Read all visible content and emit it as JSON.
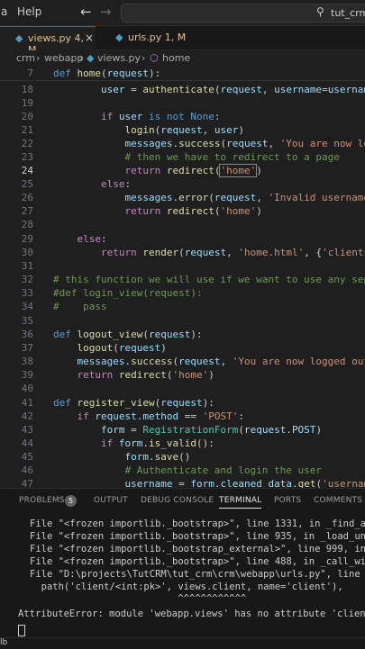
{
  "menu": {
    "item1": "a",
    "help": "Help"
  },
  "search": {
    "text": "tut_crm"
  },
  "tabs": [
    {
      "label": "views.py 4, M",
      "icon": "python-file-icon"
    },
    {
      "label": "urls.py 1, M",
      "icon": "python-file-icon"
    }
  ],
  "breadcrumb": {
    "part1": "crm",
    "part2": "webapp",
    "part3": "views.py",
    "part4": "home"
  },
  "editor": {
    "lines": [
      {
        "n": "7",
        "text": "def home(request):"
      },
      {
        "n": "18",
        "text": "        user = authenticate(request, username=username,"
      },
      {
        "n": "19",
        "text": ""
      },
      {
        "n": "20",
        "text": "        if user is not None:"
      },
      {
        "n": "21",
        "text": "            login(request, user)"
      },
      {
        "n": "22",
        "text": "            messages.success(request, 'You are now logge"
      },
      {
        "n": "23",
        "text": "            # then we have to redirect to a page"
      },
      {
        "n": "24",
        "text": "            return redirect('home')"
      },
      {
        "n": "25",
        "text": "        else:"
      },
      {
        "n": "26",
        "text": "            messages.error(request, 'Invalid username or"
      },
      {
        "n": "27",
        "text": "            return redirect('home')"
      },
      {
        "n": "28",
        "text": ""
      },
      {
        "n": "29",
        "text": "    else:"
      },
      {
        "n": "30",
        "text": "        return render(request, 'home.html', {'clients':"
      },
      {
        "n": "31",
        "text": ""
      },
      {
        "n": "32",
        "text": "# this function we will use if we want to use any sepera"
      },
      {
        "n": "33",
        "text": "#def login_view(request):"
      },
      {
        "n": "34",
        "text": "#    pass"
      },
      {
        "n": "35",
        "text": ""
      },
      {
        "n": "36",
        "text": "def logout_view(request):"
      },
      {
        "n": "37",
        "text": "    logout(request)"
      },
      {
        "n": "38",
        "text": "    messages.success(request, 'You are now logged out')"
      },
      {
        "n": "39",
        "text": "    return redirect('home')"
      },
      {
        "n": "40",
        "text": ""
      },
      {
        "n": "41",
        "text": "def register_view(request):"
      },
      {
        "n": "42",
        "text": "    if request.method == 'POST':"
      },
      {
        "n": "43",
        "text": "        form = RegistrationForm(request.POST)"
      },
      {
        "n": "44",
        "text": "        if form.is_valid():"
      },
      {
        "n": "45",
        "text": "            form.save()"
      },
      {
        "n": "46",
        "text": "            # Authenticate and login the user"
      },
      {
        "n": "47",
        "text": "            username = form.cleaned_data.get('username')"
      }
    ]
  },
  "panel": {
    "tabs": {
      "problems": "PROBLEMS",
      "problems_count": "5",
      "output": "OUTPUT",
      "debug": "DEBUG CONSOLE",
      "terminal": "TERMINAL",
      "ports": "PORTS",
      "comments": "COMMENTS"
    },
    "terminal": [
      "File \"<frozen importlib._bootstrap>\", line 1331, in _find_and_",
      "File \"<frozen importlib._bootstrap>\", line 935, in _load_unloc",
      "File \"<frozen importlib._bootstrap_external>\", line 999, in ex",
      "File \"<frozen importlib._bootstrap>\", line 488, in _call_with_",
      "File \"D:\\projects\\TutCRM\\tut_crm\\crm\\webapp\\urls.py\", line 10,",
      "  path('client/<int:pk>', views.client, name='client'),",
      "                          ^^^^^^^^^^^^",
      "AttributeError: module 'webapp.views' has no attribute 'client'."
    ]
  },
  "statusbar": {
    "text": "lb"
  }
}
